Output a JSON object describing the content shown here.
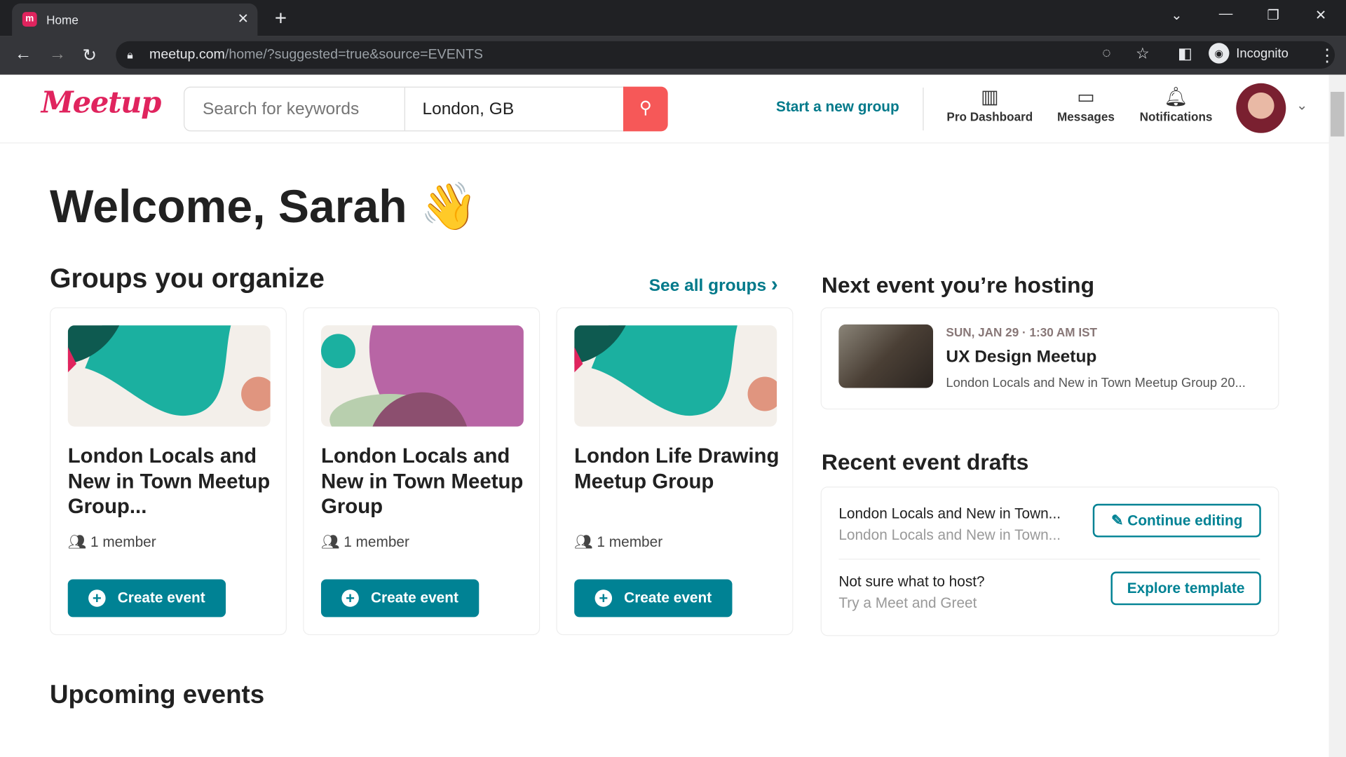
{
  "browser": {
    "tab_title": "Home",
    "url_host": "meetup.com",
    "url_path": "/home/?suggested=true&source=EVENTS",
    "profile": "Incognito"
  },
  "header": {
    "logo": "Meetup",
    "search_placeholder": "Search for keywords",
    "location": "London, GB",
    "start_group": "Start a new group",
    "nav": [
      {
        "label": "Pro Dashboard",
        "icon": "chart-icon"
      },
      {
        "label": "Messages",
        "icon": "message-icon"
      },
      {
        "label": "Notifications",
        "icon": "bell-icon"
      }
    ]
  },
  "main": {
    "welcome": "Welcome, Sarah 👋",
    "groups_title": "Groups you organize",
    "see_all": "See all groups",
    "groups": [
      {
        "name": "London Locals and New in Town Meetup Group...",
        "members": "1 member",
        "button": "Create event"
      },
      {
        "name": "London Locals and New in Town Meetup Group",
        "members": "1 member",
        "button": "Create event"
      },
      {
        "name": "London Life Drawing Meetup Group",
        "members": "1 member",
        "button": "Create event"
      }
    ],
    "next_title": "Next event you’re hosting",
    "next_event": {
      "date": "SUN, JAN 29 · 1:30 AM IST",
      "title": "UX Design Meetup",
      "group": "London Locals and New in Town Meetup Group 20..."
    },
    "drafts_title": "Recent event drafts",
    "drafts": [
      {
        "title": "London Locals and New in Town...",
        "subtitle": "London Locals and New in Town...",
        "button": "Continue editing"
      },
      {
        "title": "Not sure what to host?",
        "subtitle": "Try a Meet and Greet",
        "button": "Explore template"
      }
    ],
    "upcoming_title": "Upcoming events"
  },
  "colors": {
    "brand": "#e0245e",
    "teal": "#008294",
    "search_btn": "#f65858"
  }
}
